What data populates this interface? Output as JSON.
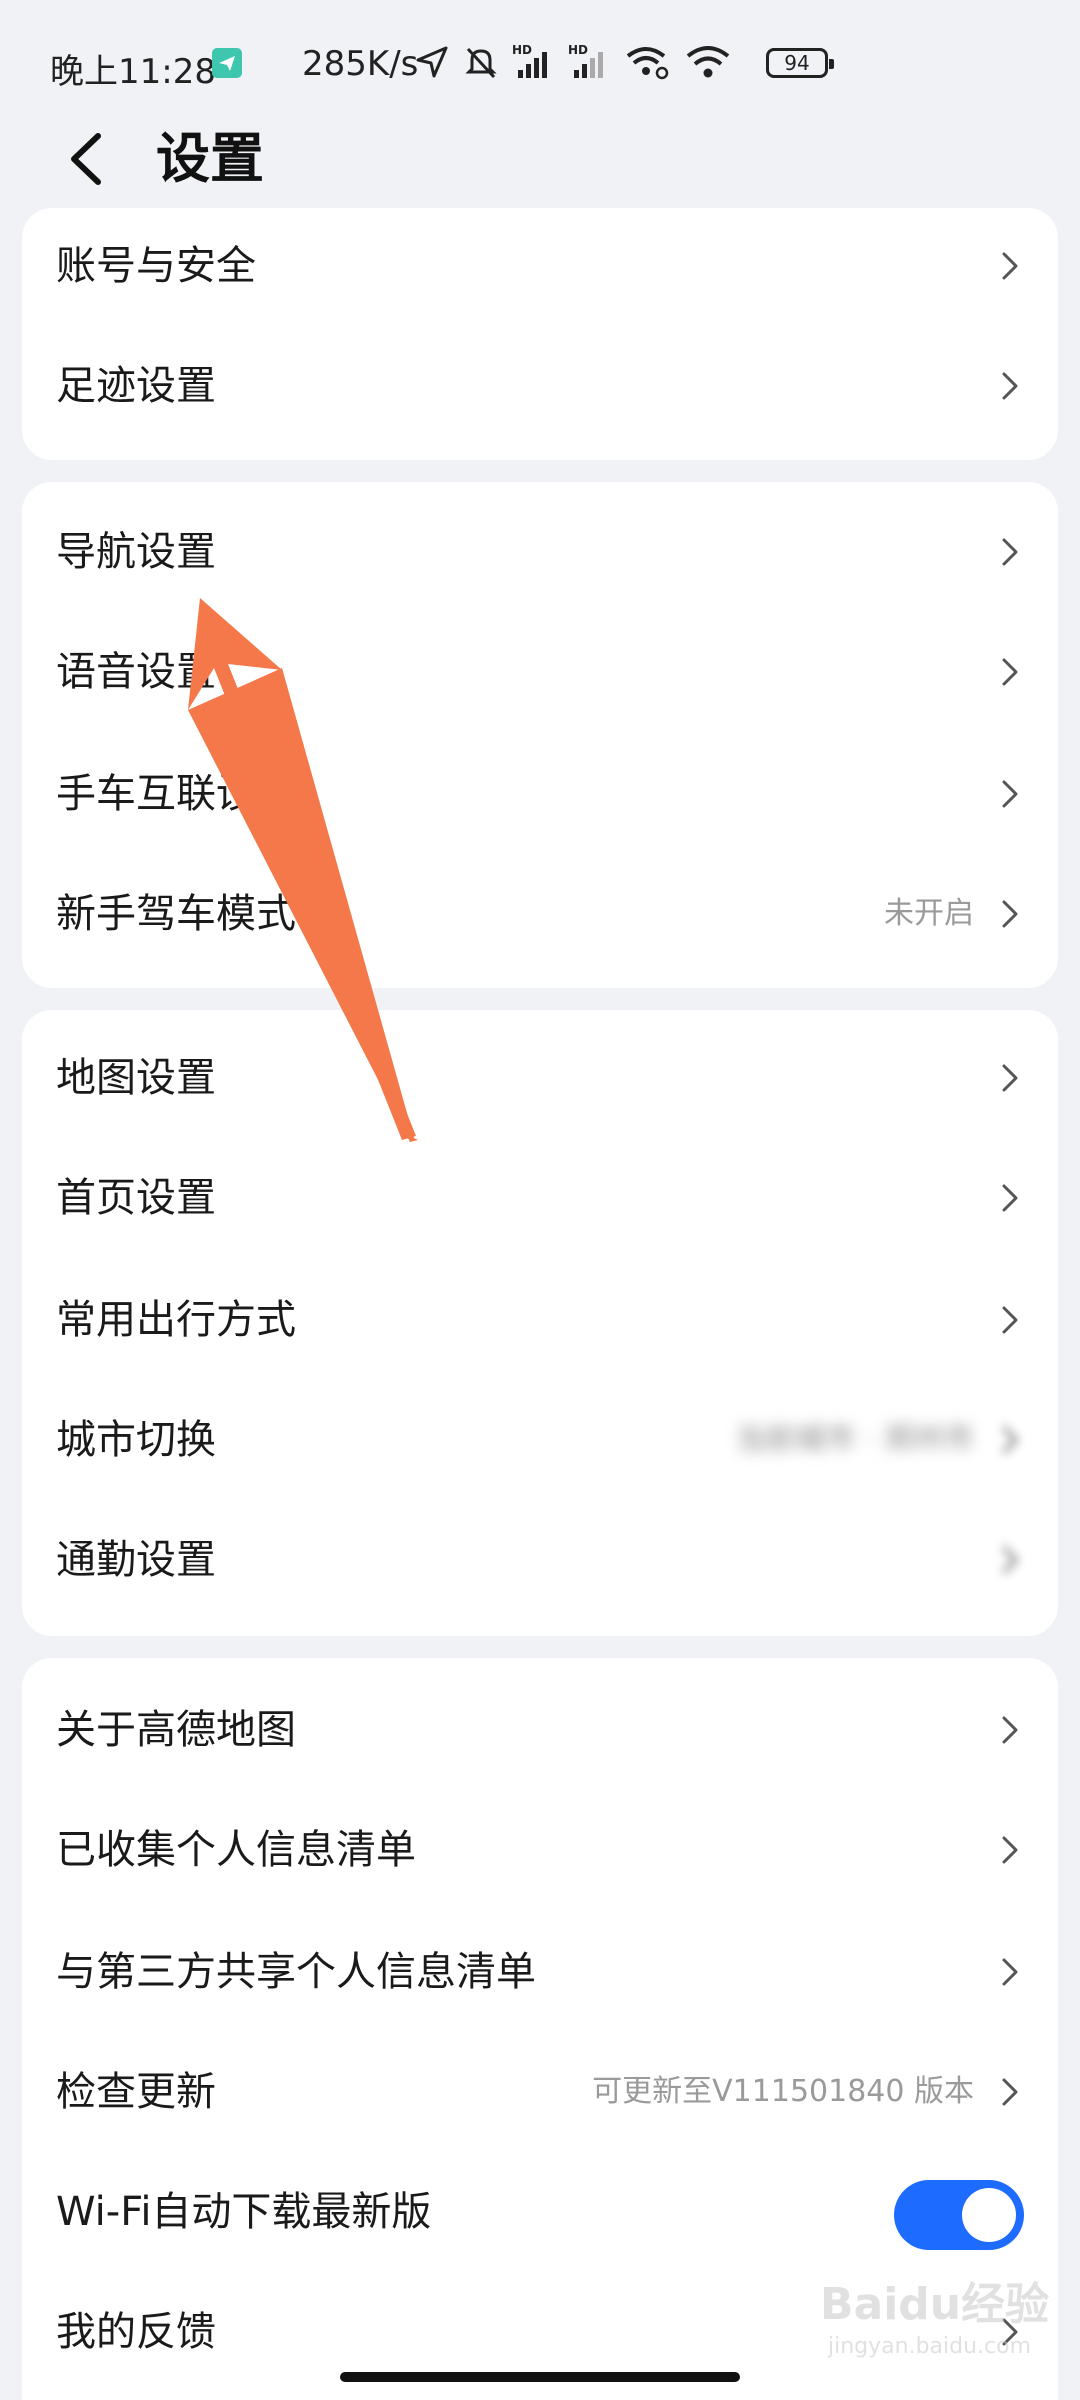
{
  "status_bar": {
    "time": "晚上11:28",
    "speed": "285K/s",
    "battery": "94",
    "icons": [
      "telegram-icon",
      "location-arrow-icon",
      "bell-muted-icon",
      "hd-signal-icon",
      "hd-signal-weak-icon",
      "wifi-link-icon",
      "wifi-icon",
      "battery-icon"
    ]
  },
  "header": {
    "title": "设置",
    "back_icon": "chevron-left-icon"
  },
  "groups": [
    {
      "rows": [
        {
          "label": "账号与安全"
        },
        {
          "label": "足迹设置"
        }
      ]
    },
    {
      "rows": [
        {
          "label": "导航设置"
        },
        {
          "label": "语音设置"
        },
        {
          "label": "手车互联设置"
        },
        {
          "label": "新手驾车模式",
          "value": "未开启"
        }
      ]
    },
    {
      "rows": [
        {
          "label": "地图设置"
        },
        {
          "label": "首页设置"
        },
        {
          "label": "常用出行方式"
        },
        {
          "label": "城市切换",
          "value": "当前城市 · 郑州市",
          "blurred": true
        },
        {
          "label": "通勤设置",
          "blurred_chevron": true
        }
      ]
    },
    {
      "rows": [
        {
          "label": "关于高德地图"
        },
        {
          "label": "已收集个人信息清单"
        },
        {
          "label": "与第三方共享个人信息清单"
        },
        {
          "label": "检查更新",
          "value": "可更新至V111501840 版本"
        },
        {
          "label": "Wi-Fi自动下载最新版",
          "toggle": true
        },
        {
          "label": "我的反馈"
        }
      ]
    }
  ],
  "annotation": {
    "type": "arrow",
    "color": "#f4784a"
  },
  "watermark": {
    "logo": "Baidu经验",
    "sub": "jingyan.baidu.com"
  },
  "colors": {
    "background": "#f1f2f6",
    "card": "#ffffff",
    "toggle_on": "#1e6cff",
    "secondary_text": "#9a9a9a"
  }
}
